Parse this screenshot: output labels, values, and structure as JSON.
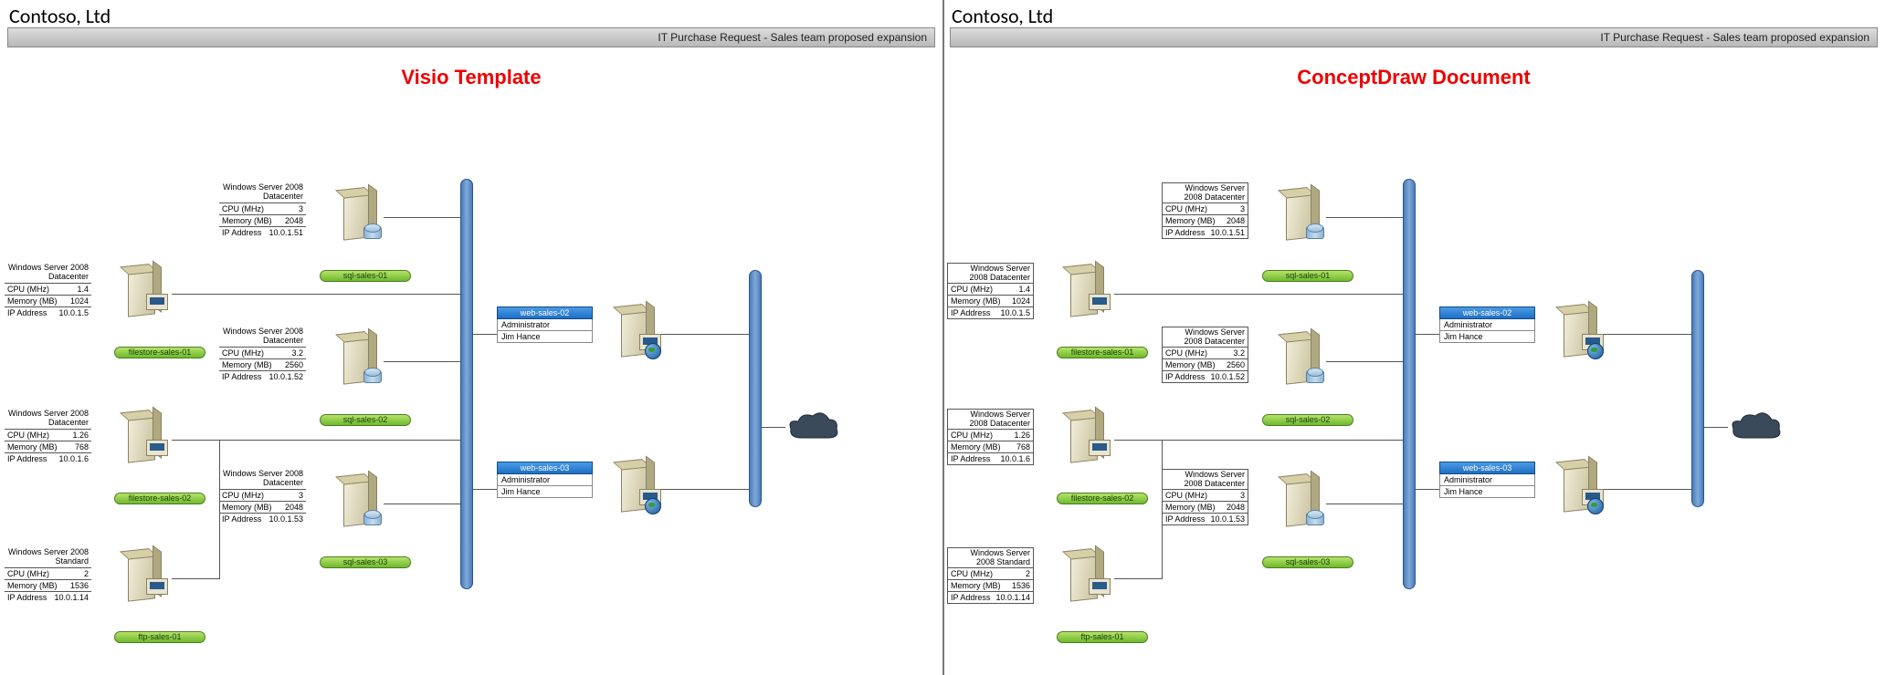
{
  "company": "Contoso, Ltd",
  "subtitle": "IT Purchase Request - Sales team proposed expansion",
  "left_headline": "Visio Template",
  "right_headline": "ConceptDraw Document",
  "spec_labels": {
    "cpu": "CPU (MHz)",
    "mem": "Memory (MB)",
    "ip": "IP Address"
  },
  "servers": {
    "filestore1": {
      "os": "Windows Server 2008 Datacenter",
      "cpu": "1.4",
      "mem": "1024",
      "ip": "10.0.1.5",
      "label": "filestore-sales-01"
    },
    "filestore2": {
      "os": "Windows Server 2008 Datacenter",
      "cpu": "1.26",
      "mem": "768",
      "ip": "10.0.1.6",
      "label": "filestore-sales-02"
    },
    "ftp1": {
      "os": "Windows Server 2008 Standard",
      "cpu": "2",
      "mem": "1536",
      "ip": "10.0.1.14",
      "label": "ftp-sales-01"
    },
    "sql1": {
      "os": "Windows Server 2008 Datacenter",
      "cpu": "3",
      "mem": "2048",
      "ip": "10.0.1.51",
      "label": "sql-sales-01"
    },
    "sql2": {
      "os": "Windows Server 2008 Datacenter",
      "cpu": "3.2",
      "mem": "2560",
      "ip": "10.0.1.52",
      "label": "sql-sales-02"
    },
    "sql3": {
      "os": "Windows Server 2008 Datacenter",
      "cpu": "3",
      "mem": "2048",
      "ip": "10.0.1.53",
      "label": "sql-sales-03"
    },
    "web2": {
      "name": "web-sales-02",
      "admin_l": "Administrator",
      "admin_v": "Jim Hance"
    },
    "web3": {
      "name": "web-sales-03",
      "admin_l": "Administrator",
      "admin_v": "Jim Hance"
    }
  }
}
